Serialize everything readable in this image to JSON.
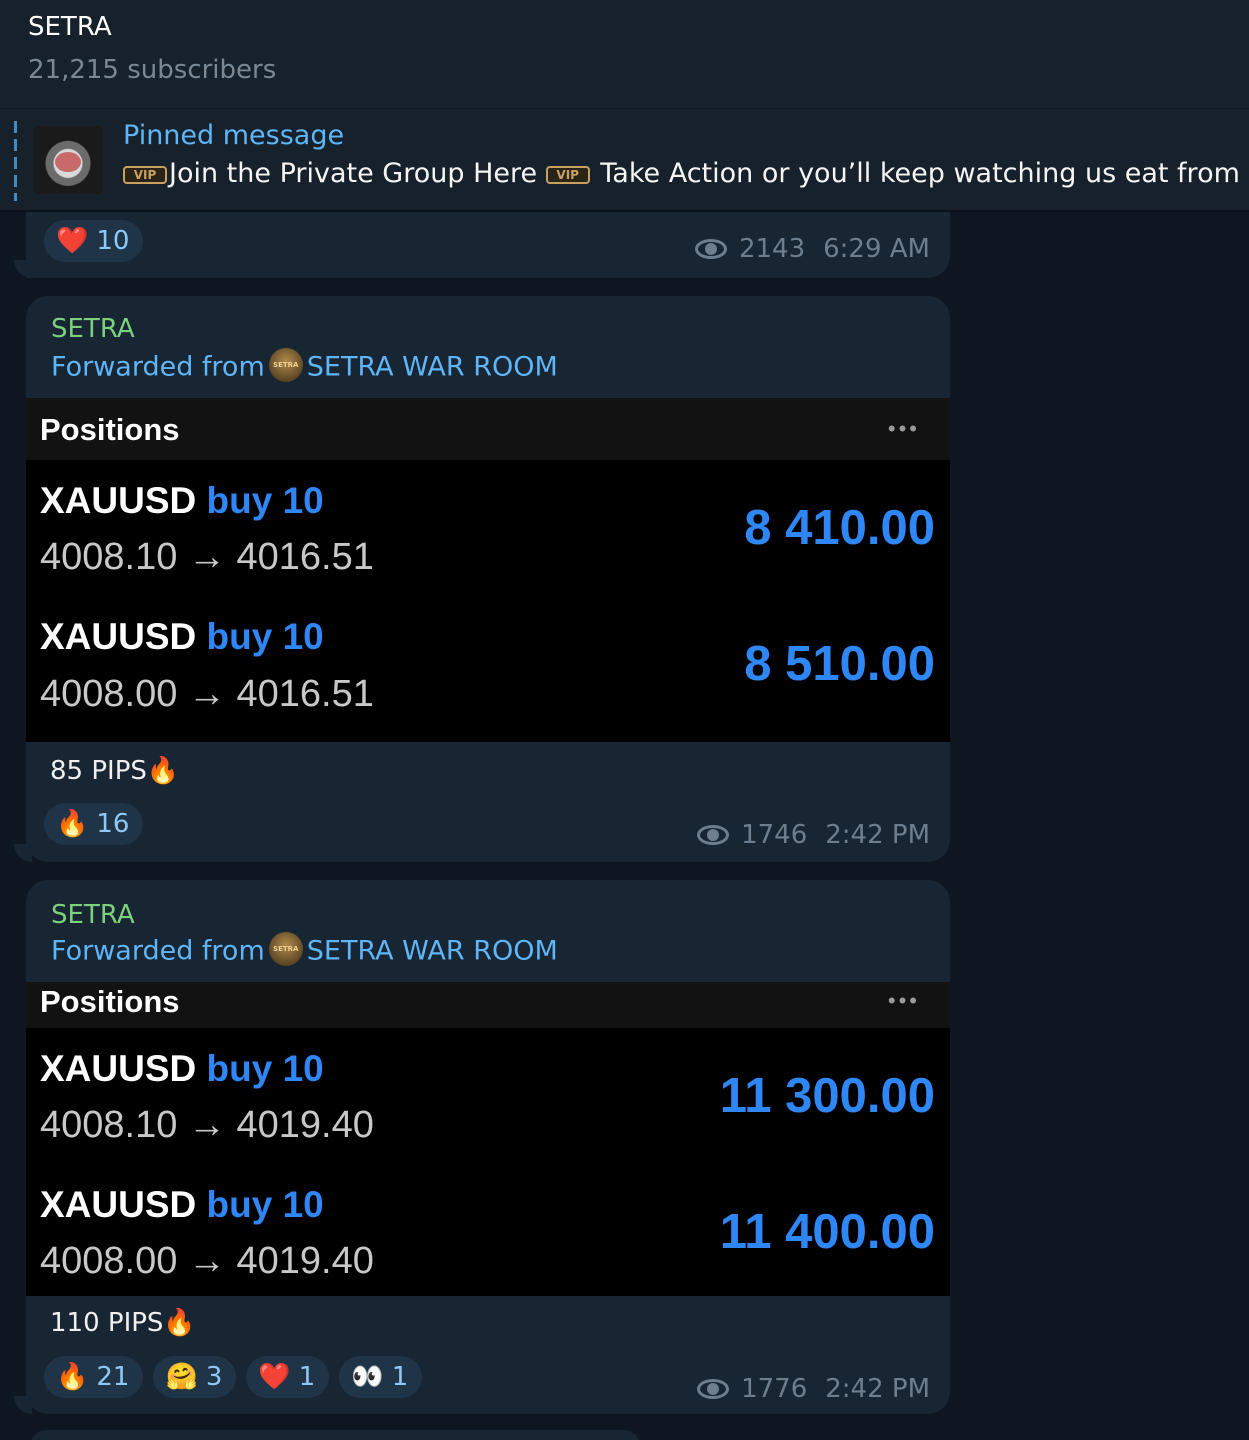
{
  "channel": {
    "title": "SETRA",
    "subscribers": "21,215 subscribers"
  },
  "pinned": {
    "title": "Pinned message",
    "text_a": "Join the Private Group Here",
    "text_b": " Take Action or you’ll keep watching us eat from the",
    "vip_badge": "VIP"
  },
  "msg0": {
    "reaction_emoji": "❤️",
    "reaction_count": "10",
    "views": "2143",
    "time": "6:29 AM"
  },
  "msg1": {
    "sender": "SETRA",
    "forward_prefix": "Forwarded from",
    "forward_from": "SETRA WAR ROOM",
    "forward_avatar_text": "SETRA",
    "image": {
      "header": "Positions",
      "menu": "•••",
      "rows": [
        {
          "symbol": "XAUUSD",
          "direction": "buy 10",
          "prices": "4008.10 → 4016.51",
          "profit": "8 410.00"
        },
        {
          "symbol": "XAUUSD",
          "direction": "buy 10",
          "prices": "4008.00 → 4016.51",
          "profit": "8 510.00"
        }
      ]
    },
    "caption": "85 PIPS",
    "caption_emoji": "🔥",
    "reactions": [
      {
        "emoji": "🔥",
        "count": "16"
      }
    ],
    "views": "1746",
    "time": "2:42 PM"
  },
  "msg2": {
    "sender": "SETRA",
    "forward_prefix": "Forwarded from",
    "forward_from": "SETRA WAR ROOM",
    "forward_avatar_text": "SETRA",
    "image": {
      "header": "Positions",
      "menu": "•••",
      "rows": [
        {
          "symbol": "XAUUSD",
          "direction": "buy 10",
          "prices": "4008.10 → 4019.40",
          "profit": "11 300.00"
        },
        {
          "symbol": "XAUUSD",
          "direction": "buy 10",
          "prices": "4008.00 → 4019.40",
          "profit": "11 400.00"
        }
      ]
    },
    "caption": "110 PIPS",
    "caption_emoji": "🔥",
    "reactions": [
      {
        "emoji": "🔥",
        "count": "21"
      },
      {
        "emoji": "🤗",
        "count": "3"
      },
      {
        "emoji": "❤️",
        "count": "1"
      },
      {
        "emoji": "👀",
        "count": "1"
      }
    ],
    "views": "1776",
    "time": "2:42 PM"
  },
  "colors": {
    "background": "#0e1621",
    "bubble": "#182533",
    "accent": "#5eb5f7",
    "sender": "#7cd17d",
    "profit": "#2f86f5"
  },
  "icons": {
    "views": "eye-icon",
    "menu": "more-dots-icon"
  }
}
